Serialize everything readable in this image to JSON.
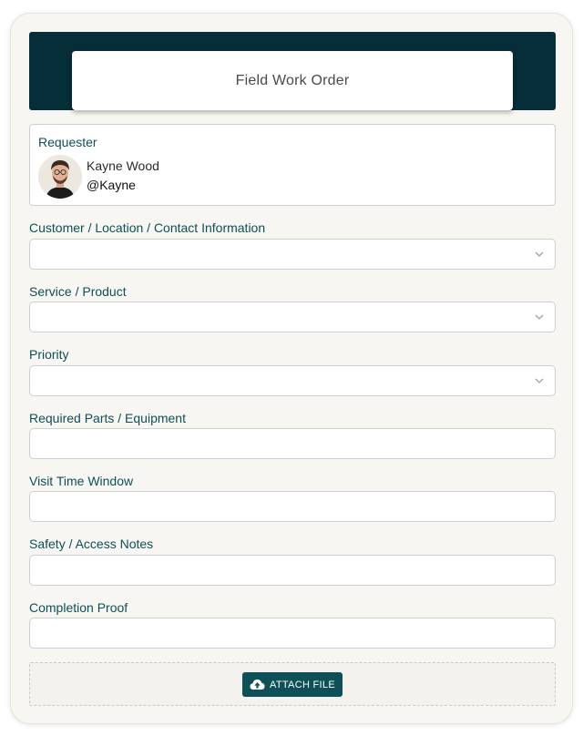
{
  "form": {
    "title": "Field Work Order"
  },
  "requester": {
    "label": "Requester",
    "name": "Kayne Wood",
    "handle": "@Kayne"
  },
  "fields": {
    "customer": {
      "label": "Customer / Location / Contact Information",
      "value": "",
      "type": "dropdown"
    },
    "service": {
      "label": "Service / Product",
      "value": "",
      "type": "dropdown"
    },
    "priority": {
      "label": "Priority",
      "value": "",
      "type": "dropdown"
    },
    "parts": {
      "label": "Required Parts / Equipment",
      "value": "",
      "type": "text"
    },
    "visit_window": {
      "label": "Visit Time Window",
      "value": "",
      "type": "text"
    },
    "safety_notes": {
      "label": "Safety / Access Notes",
      "value": "",
      "type": "text"
    },
    "completion_proof": {
      "label": "Completion Proof",
      "value": "",
      "type": "text"
    }
  },
  "attach": {
    "button_label": "ATTACH FILE"
  },
  "icons": {
    "avatar": "user-avatar",
    "dropdown": "chevron-down-icon",
    "attach": "cloud-upload-icon"
  },
  "colors": {
    "header": "#062e38",
    "accent": "#0d5057",
    "background": "#f7f6f2"
  }
}
